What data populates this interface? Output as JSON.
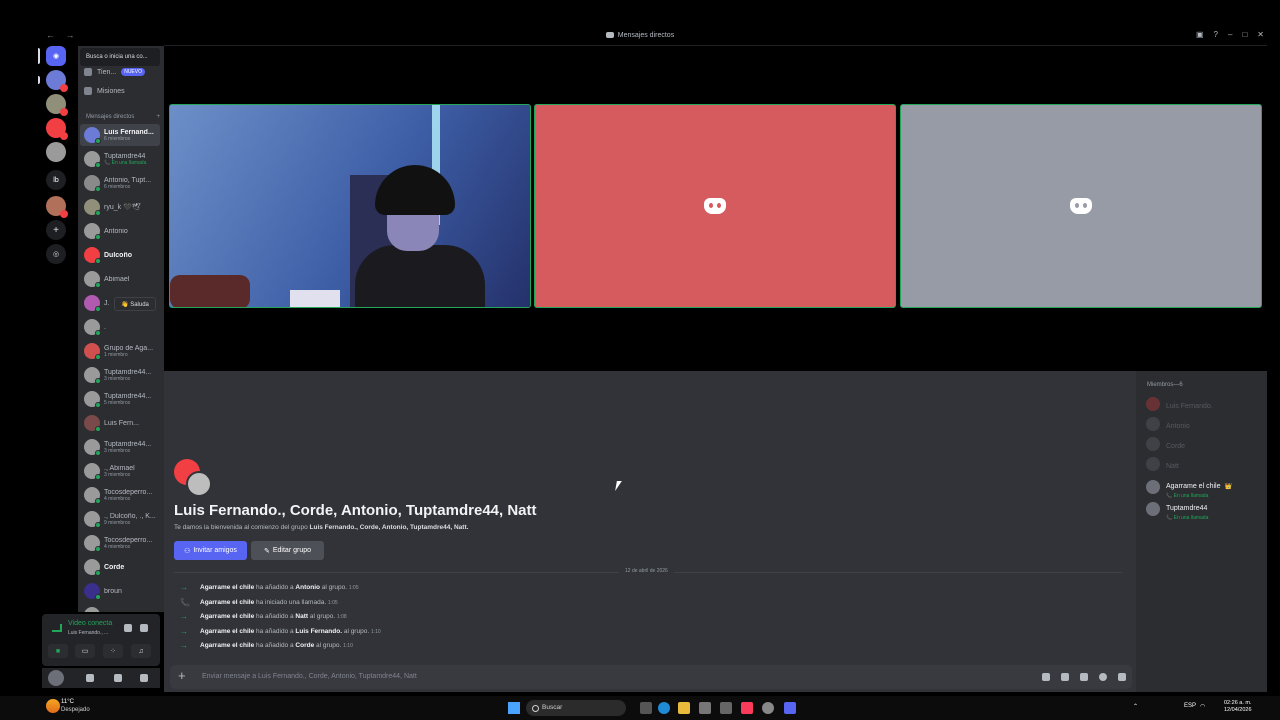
{
  "window": {
    "title": "Mensajes directos",
    "nav_arrows": "← →"
  },
  "search": {
    "placeholder": "Busca o inicia una co..."
  },
  "nav": [
    {
      "label": "Tien...",
      "badge": "NUEVO"
    },
    {
      "label": "Misiones"
    }
  ],
  "dm_header": {
    "label": "Mensajes directos",
    "add": "+"
  },
  "dms": [
    {
      "name": "Luis Fernand...",
      "sub": "6 miembros",
      "bold": false,
      "active": true
    },
    {
      "name": "Tuptamdre44",
      "sub": "📞 En una llamada",
      "call": true
    },
    {
      "name": "Antonio, Tupt...",
      "sub": "6 miembros"
    },
    {
      "name": "ryu_k 🖤🕊",
      "sub": ""
    },
    {
      "name": "Antonio",
      "sub": ""
    },
    {
      "name": "Dulcoño",
      "sub": "",
      "bold": true
    },
    {
      "name": "Abimael",
      "sub": ""
    },
    {
      "name": "J.",
      "sub": ""
    },
    {
      "name": ".",
      "sub": ""
    },
    {
      "name": "Grupo de Aga...",
      "sub": "1 miembro"
    },
    {
      "name": "Tuptamdre44...",
      "sub": "3 miembros"
    },
    {
      "name": "Tuptamdre44...",
      "sub": "5 miembros"
    },
    {
      "name": "Luis Fern...",
      "sub": ""
    },
    {
      "name": "Tuptamdre44...",
      "sub": "3 miembros"
    },
    {
      "name": "., Abimael",
      "sub": "3 miembros"
    },
    {
      "name": "Tocosdeperro...",
      "sub": "4 miembros"
    },
    {
      "name": "., Dulcoño, ., K...",
      "sub": "9 miembros"
    },
    {
      "name": "Tocosdeperro...",
      "sub": "4 miembros"
    },
    {
      "name": "Corde",
      "sub": "",
      "bold": true
    },
    {
      "name": "broun",
      "sub": ""
    },
    {
      "name": "Corde, Mis nu...",
      "sub": ""
    }
  ],
  "saluda": "👋 Saluda",
  "servers": [
    {
      "label": ""
    },
    {
      "label": ""
    },
    {
      "label": ""
    },
    {
      "label": ""
    },
    {
      "label": "lb"
    },
    {
      "label": ""
    }
  ],
  "voice": {
    "status": "Video conecta",
    "channel": "Luis Fernando., ..."
  },
  "chat": {
    "group_title": "Luis Fernando., Corde, Antonio, Tuptamdre44, Natt",
    "welcome_prefix": "Te damos la bienvenida al comienzo del grupo",
    "welcome_names": "Luis Fernando., Corde, Antonio, Tuptamdre44, Natt.",
    "invite_label": "Invitar amigos",
    "edit_label": "Editar grupo",
    "date_divider": "12 de abril de 2026",
    "messages": [
      {
        "icon": "→",
        "actor": "Agarrame el chile",
        "verb": "ha añadido a",
        "target": "Antonio",
        "tail": "al grupo.",
        "time": "1:05"
      },
      {
        "icon": "📞",
        "actor": "Agarrame el chile",
        "verb": "ha iniciado una llamada.",
        "target": "",
        "tail": "",
        "time": "1:05"
      },
      {
        "icon": "→",
        "actor": "Agarrame el chile",
        "verb": "ha añadido a",
        "target": "Natt",
        "tail": "al grupo.",
        "time": "1:08"
      },
      {
        "icon": "→",
        "actor": "Agarrame el chile",
        "verb": "ha añadido a",
        "target": "Luis Fernando.",
        "tail": "al grupo.",
        "time": "1:10"
      },
      {
        "icon": "→",
        "actor": "Agarrame el chile",
        "verb": "ha añadido a",
        "target": "Corde",
        "tail": "al grupo.",
        "time": "1:10"
      }
    ],
    "composer_placeholder": "Enviar mensaje a Luis Fernando., Corde, Antonio, Tuptamdre44, Natt"
  },
  "members": {
    "header": "Miembros—6",
    "list": [
      {
        "name": "Luis Fernando.",
        "online": false
      },
      {
        "name": "Antonio",
        "online": false
      },
      {
        "name": "Corde",
        "online": false
      },
      {
        "name": "Natt",
        "online": false
      },
      {
        "name": "Agarrame el chile",
        "online": true,
        "sub": "📞 En una llamada",
        "crown": "👑"
      },
      {
        "name": "Tuptamdre44",
        "online": true,
        "sub": "📞 En una llamada"
      }
    ]
  },
  "taskbar": {
    "weather_temp": "11°C",
    "weather_desc": "Despejado",
    "search": "Buscar",
    "lang": "ESP",
    "time": "02:26 a. m.",
    "date": "12/04/2026"
  },
  "colors": {
    "accent": "#5865f2",
    "online": "#23a55a",
    "red_tile": "#d55b5f",
    "grey_tile": "#979ba6"
  }
}
